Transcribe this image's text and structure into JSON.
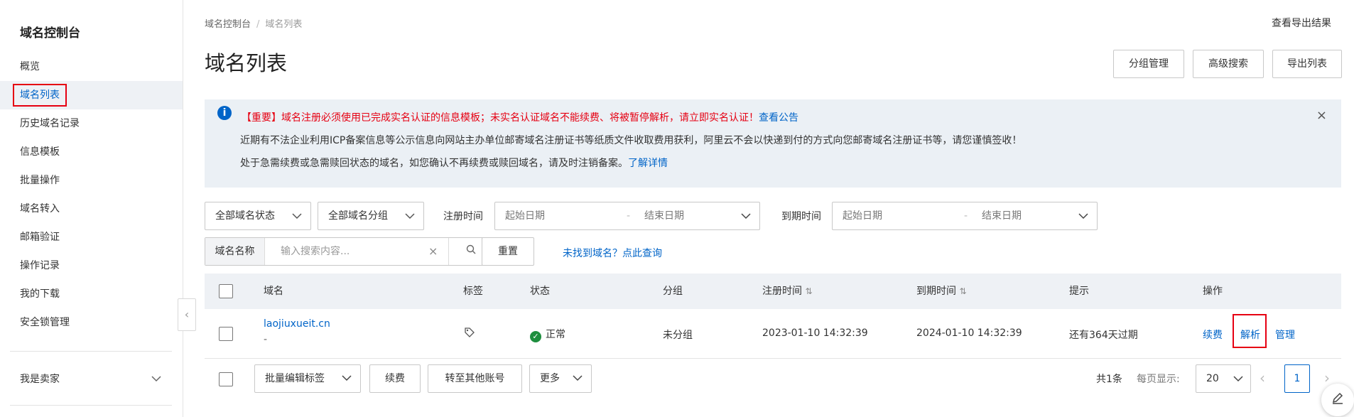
{
  "sidebar": {
    "title": "域名控制台",
    "items": [
      {
        "label": "概览"
      },
      {
        "label": "域名列表",
        "active": true
      },
      {
        "label": "历史域名记录"
      },
      {
        "label": "信息模板"
      },
      {
        "label": "批量操作"
      },
      {
        "label": "域名转入"
      },
      {
        "label": "邮箱验证"
      },
      {
        "label": "操作记录"
      },
      {
        "label": "我的下载"
      },
      {
        "label": "安全锁管理"
      }
    ],
    "seller": "我是卖家",
    "collapse_icon": "‹"
  },
  "breadcrumb": {
    "root": "域名控制台",
    "sep": "/",
    "current": "域名列表"
  },
  "header": {
    "title": "域名列表",
    "export_result": "查看导出结果",
    "buttons": {
      "group": "分组管理",
      "advanced": "高级搜索",
      "export": "导出列表"
    }
  },
  "notice": {
    "icon": "i",
    "line1": "【重要】域名注册必须使用已完成实名认证的信息模板；未实名认证域名不能续费、将被暂停解析，请立即实名认证！",
    "line1_link": "查看公告",
    "line2": "近期有不法企业利用ICP备案信息等公示信息向网站主办单位邮寄域名注册证书等纸质文件收取费用获利，阿里云不会以快递到付的方式向您邮寄域名注册证书等，请您谨慎签收！",
    "line3": "处于急需续费或急需赎回状态的域名，如您确认不再续费或赎回域名，请及时注销备案。",
    "line3_link": "了解详情",
    "close": "×"
  },
  "filters": {
    "status": "全部域名状态",
    "group": "全部域名分组",
    "reg_label": "注册时间",
    "exp_label": "到期时间",
    "start_ph": "起始日期",
    "date_sep": "-",
    "end_ph": "结束日期",
    "search_label": "域名名称",
    "search_ph": "输入搜索内容...",
    "clear": "×",
    "reset": "重置",
    "not_found": "未找到域名？点此查询"
  },
  "table": {
    "headers": {
      "domain": "域名",
      "tag": "标签",
      "status": "状态",
      "group": "分组",
      "reg": "注册时间",
      "exp": "到期时间",
      "tip": "提示",
      "ops": "操作"
    },
    "sort_icon": "⇅",
    "row": {
      "domain": "laojiuxueit.cn",
      "sub": "-",
      "status": "正常",
      "group": "未分组",
      "reg": "2023-01-10 14:32:39",
      "exp": "2024-01-10 14:32:39",
      "tip": "还有364天过期",
      "renew": "续费",
      "resolve": "解析",
      "manage": "管理"
    }
  },
  "footer": {
    "batch_tag": "批量编辑标签",
    "renew": "续费",
    "transfer": "转至其他账号",
    "more": "更多",
    "total": "共1条",
    "per_page_label": "每页显示:",
    "per_page": "20",
    "page": "1"
  },
  "colors": {
    "accent": "#0064c8",
    "highlight": "#e60012",
    "brand": "#ff6a00",
    "ok": "#1e8e3e"
  }
}
